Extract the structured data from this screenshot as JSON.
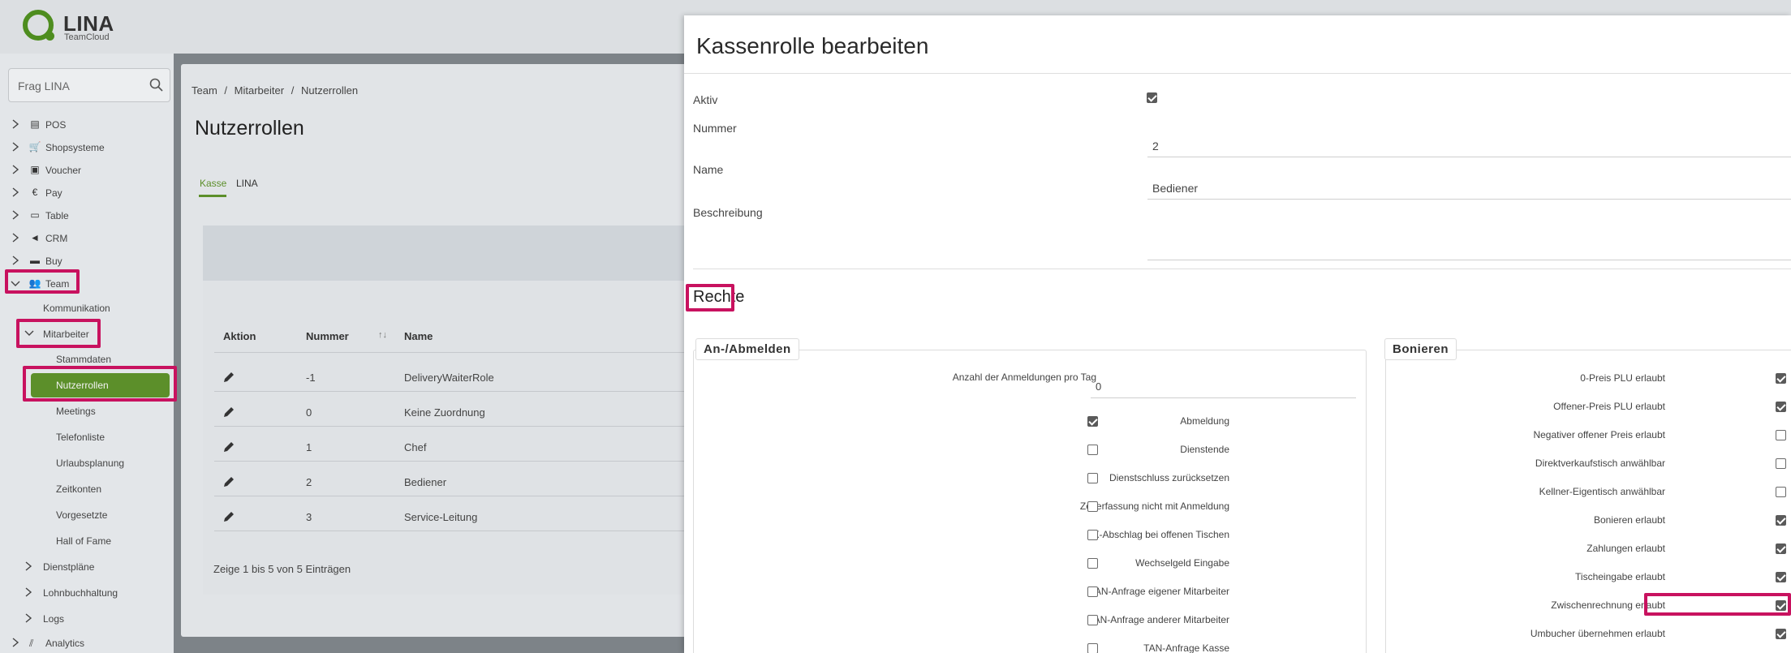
{
  "app": {
    "logo_name": "LINA",
    "logo_sub": "TeamCloud"
  },
  "sidebar": {
    "search_placeholder": "Frag LINA",
    "items": [
      {
        "label": "POS",
        "icon": "cash-register-icon",
        "glyph": "▤"
      },
      {
        "label": "Shopsysteme",
        "icon": "cart-icon",
        "glyph": "🛒"
      },
      {
        "label": "Voucher",
        "icon": "gift-icon",
        "glyph": "▣"
      },
      {
        "label": "Pay",
        "icon": "euro-icon",
        "glyph": "€"
      },
      {
        "label": "Table",
        "icon": "book-icon",
        "glyph": "▭"
      },
      {
        "label": "CRM",
        "icon": "megaphone-icon",
        "glyph": "◄"
      },
      {
        "label": "Buy",
        "icon": "truck-icon",
        "glyph": "▬"
      },
      {
        "label": "Team",
        "icon": "users-icon",
        "glyph": "👥"
      }
    ],
    "team_children": {
      "kommunikation": "Kommunikation",
      "mitarbeiter": "Mitarbeiter",
      "mitarbeiter_children": [
        "Stammdaten",
        "Nutzerrollen",
        "Meetings",
        "Telefonliste",
        "Urlaubsplanung",
        "Zeitkonten",
        "Vorgesetzte",
        "Hall of Fame"
      ],
      "dienstplaene": "Dienstpläne",
      "lohnbuchhaltung": "Lohnbuchhaltung",
      "logs": "Logs"
    },
    "analytics": "Analytics"
  },
  "main": {
    "breadcrumb": [
      "Team",
      "Mitarbeiter",
      "Nutzerrollen"
    ],
    "breadcrumb_sep": "/",
    "title": "Nutzerrollen",
    "tabs": [
      "Kasse",
      "LINA"
    ],
    "table": {
      "headers": [
        "Aktion",
        "Nummer",
        "Name"
      ],
      "sort_indicator": "↑↓",
      "rows": [
        {
          "nummer": "-1",
          "name": "DeliveryWaiterRole"
        },
        {
          "nummer": "0",
          "name": "Keine Zuordnung"
        },
        {
          "nummer": "1",
          "name": "Chef"
        },
        {
          "nummer": "2",
          "name": "Bediener"
        },
        {
          "nummer": "3",
          "name": "Service-Leitung"
        }
      ],
      "footer": "Zeige 1 bis 5 von 5 Einträgen"
    }
  },
  "modal": {
    "title": "Kassenrolle bearbeiten",
    "fields": {
      "aktiv_label": "Aktiv",
      "aktiv_checked": true,
      "nummer_label": "Nummer",
      "nummer_value": "2",
      "name_label": "Name",
      "name_value": "Bediener",
      "beschreibung_label": "Beschreibung",
      "beschreibung_value": ""
    },
    "section_title": "Rechte",
    "groups": [
      {
        "legend": "An-/Abmelden",
        "number_field": {
          "label": "Anzahl der Anmeldungen pro Tag",
          "value": "0"
        },
        "items": [
          {
            "label": "Abmeldung",
            "checked": true
          },
          {
            "label": "Dienstende",
            "checked": false
          },
          {
            "label": "Dienstschluss zurücksetzen",
            "checked": false
          },
          {
            "label": "Zeiterfassung nicht mit Anmeldung",
            "checked": false
          },
          {
            "label": "X-Abschlag bei offenen Tischen",
            "checked": false
          },
          {
            "label": "Wechselgeld Eingabe",
            "checked": false
          },
          {
            "label": "TAN-Anfrage eigener Mitarbeiter",
            "checked": false
          },
          {
            "label": "TAN-Anfrage anderer Mitarbeiter",
            "checked": false
          },
          {
            "label": "TAN-Anfrage Kasse",
            "checked": false
          }
        ]
      },
      {
        "legend": "Bonieren",
        "items": [
          {
            "label": "0-Preis PLU erlaubt",
            "checked": true
          },
          {
            "label": "Offener-Preis PLU erlaubt",
            "checked": true
          },
          {
            "label": "Negativer offener Preis erlaubt",
            "checked": false
          },
          {
            "label": "Direktverkaufstisch anwählbar",
            "checked": false
          },
          {
            "label": "Kellner-Eigentisch anwählbar",
            "checked": false
          },
          {
            "label": "Bonieren erlaubt",
            "checked": true
          },
          {
            "label": "Zahlungen erlaubt",
            "checked": true
          },
          {
            "label": "Tischeingabe erlaubt",
            "checked": true
          },
          {
            "label": "Zwischenrechnung erlaubt",
            "checked": true
          },
          {
            "label": "Umbucher übernehmen erlaubt",
            "checked": true
          }
        ]
      }
    ]
  },
  "colors": {
    "brand_green": "#5c8f2a",
    "highlight_magenta": "#c8125f"
  }
}
